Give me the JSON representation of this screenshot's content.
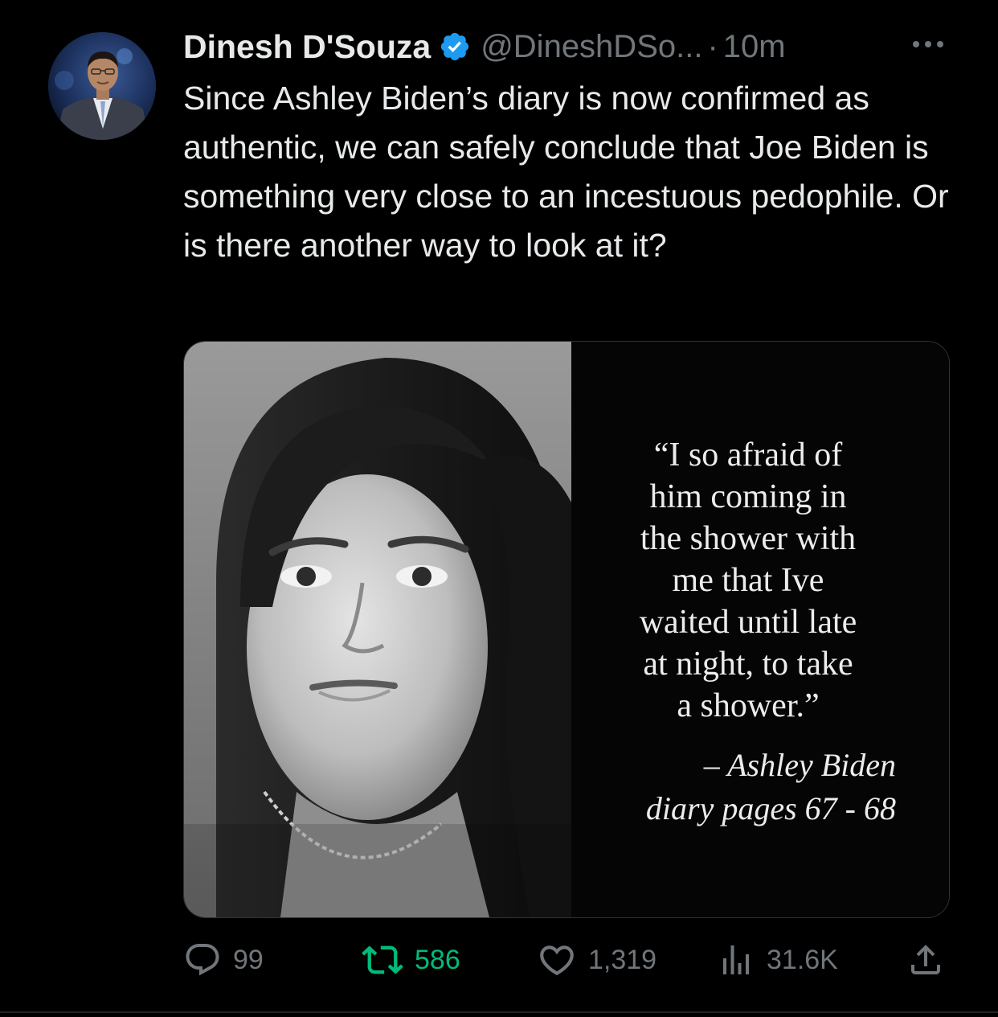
{
  "author": {
    "name": "Dinesh D'Souza",
    "handle": "@DineshDSo...",
    "separator": "·",
    "time": "10m",
    "verified": true,
    "avatar_icon": "profile-photo"
  },
  "more_icon": "more-options-icon",
  "tweet": {
    "text": "Since Ashley Biden’s diary is now confirmed as authentic, we can safely conclude that Joe Biden is something very close to an incestuous pedophile. Or is there another way to look at it?"
  },
  "media": {
    "photo_icon": "woman-portrait-photo",
    "quote_lines": [
      "“I so afraid of",
      "him coming in",
      "the shower with",
      "me that Ive",
      "waited until late",
      "at night, to take",
      "a shower.”"
    ],
    "attribution_lines": [
      "– Ashley Biden",
      "diary pages 67 - 68"
    ]
  },
  "actions": {
    "replies": "99",
    "retweets": "586",
    "likes": "1,319",
    "views": "31.6K"
  },
  "colors": {
    "background": "#000000",
    "text": "#e7e9ea",
    "secondary": "#71767b",
    "verified": "#1d9bf0",
    "retweet_active": "#00ba7c"
  }
}
